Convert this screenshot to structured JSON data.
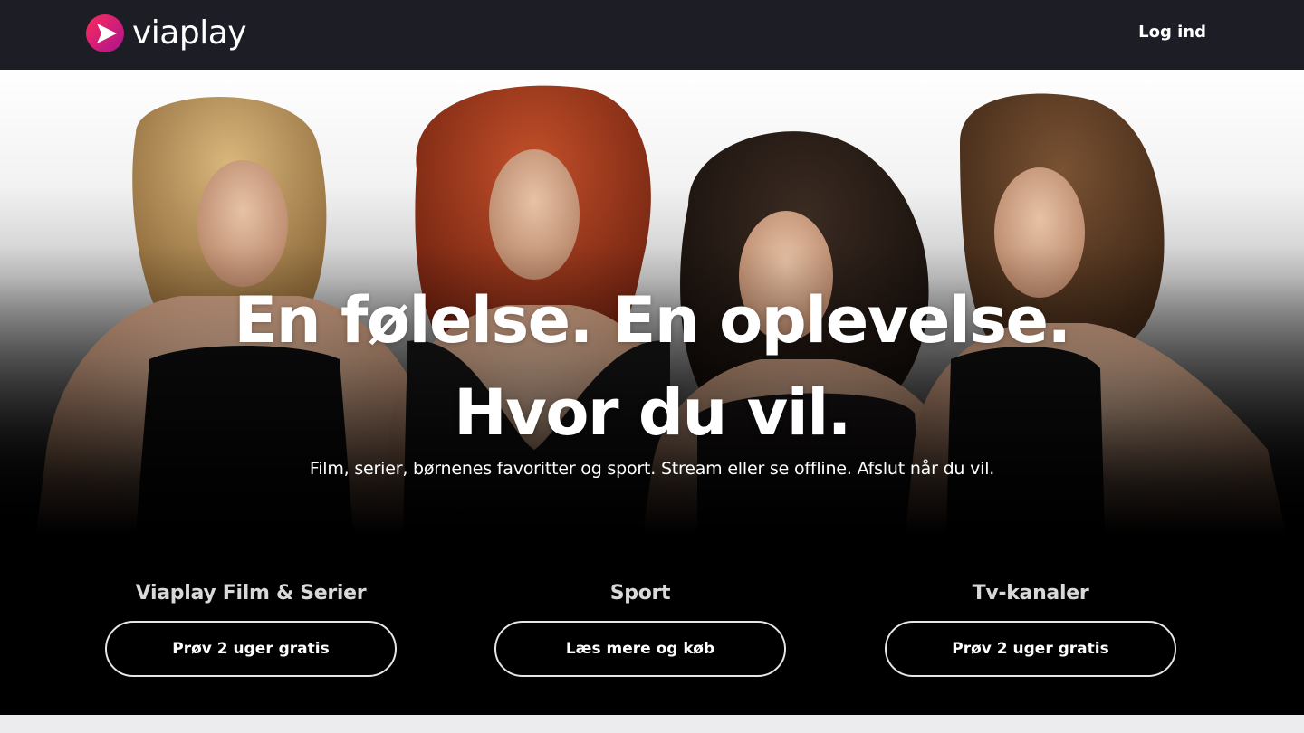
{
  "header": {
    "logo_text": "viaplay",
    "login_label": "Log ind"
  },
  "hero": {
    "headline_line1": "En følelse. En oplevelse.",
    "headline_line2": "Hvor du vil.",
    "subline": "Film, serier, børnenes favoritter og sport. Stream eller se offline. Afslut når du vil."
  },
  "offers": [
    {
      "title": "Viaplay Film & Serier",
      "button_label": "Prøv 2 uger gratis"
    },
    {
      "title": "Sport",
      "button_label": "Læs mere og køb"
    },
    {
      "title": "Tv-kanaler",
      "button_label": "Prøv 2 uger gratis"
    }
  ],
  "colors": {
    "header_bg": "#1d1d26",
    "logo_gradient_start": "#ff1e55",
    "logo_gradient_end": "#b0148c",
    "text": "#ffffff",
    "offer_title": "#d9d9d9",
    "button_border": "#e6e6e6",
    "page_bg": "#000000"
  },
  "icons": {
    "logo_mark": "viaplay-play-logo-icon"
  }
}
